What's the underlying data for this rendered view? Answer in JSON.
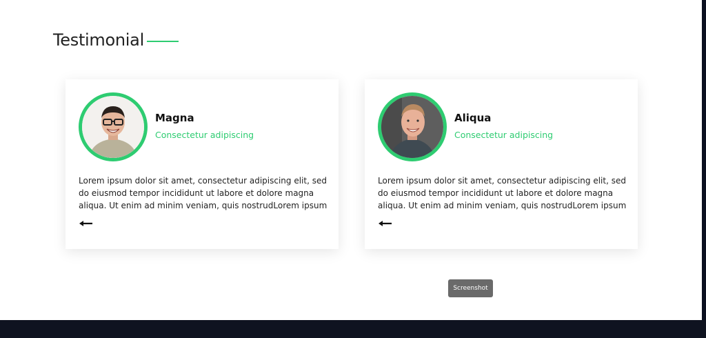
{
  "section": {
    "title": "Testimonial",
    "accent_color": "#2ecc71"
  },
  "testimonials": [
    {
      "name": "Magna",
      "role": "Consectetur adipiscing",
      "quote": "Lorem ipsum dolor sit amet, consectetur adipiscing elit, sed do eiusmod tempor incididunt ut labore et dolore magna aliqua. Ut enim ad minim veniam, quis nostrudLorem ipsum",
      "avatar_icon": "avatar-photo-man-glasses",
      "nav_icon": "arrow-left-icon"
    },
    {
      "name": "Aliqua",
      "role": "Consectetur adipiscing",
      "quote": "Lorem ipsum dolor sit amet, consectetur adipiscing elit, sed do eiusmod tempor incididunt ut labore et dolore magna aliqua. Ut enim ad minim veniam, quis nostrudLorem ipsum",
      "avatar_icon": "avatar-photo-man-smiling",
      "nav_icon": "arrow-left-icon"
    }
  ],
  "tooltip": {
    "label": "Screenshot"
  },
  "colors": {
    "accent": "#2ecc71",
    "footer": "#0f1320",
    "text": "#222222"
  }
}
